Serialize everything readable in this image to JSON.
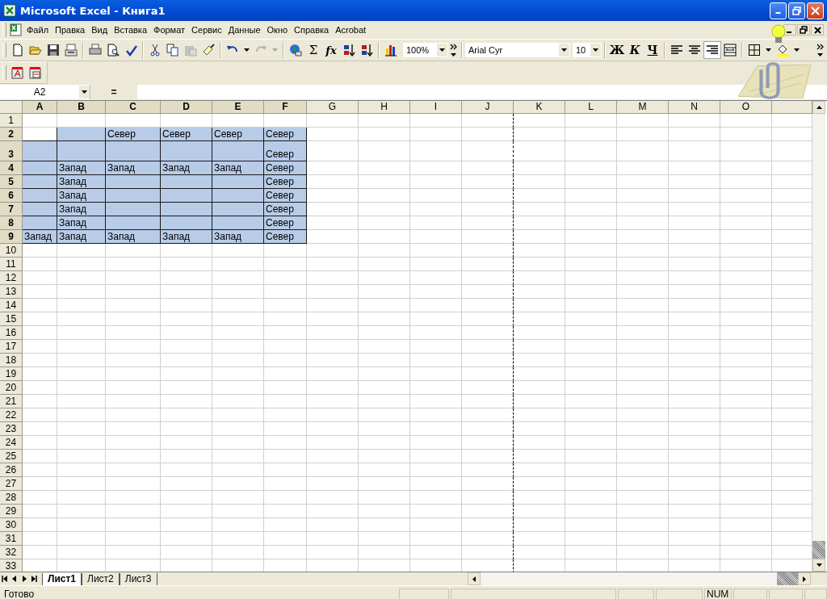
{
  "window": {
    "title": "Microsoft Excel - Книга1"
  },
  "menu": [
    "Файл",
    "Правка",
    "Вид",
    "Вставка",
    "Формат",
    "Сервис",
    "Данные",
    "Окно",
    "Справка",
    "Acrobat"
  ],
  "standard_toolbar": {
    "sum_symbol": "Σ",
    "function_symbol": "fx",
    "zoom": "100%"
  },
  "formatting_toolbar": {
    "font": "Arial Cyr",
    "size": "10",
    "bold": "Ж",
    "italic": "К",
    "underline": "Ч",
    "alignment": [
      {
        "selected": false
      },
      {
        "selected": false
      },
      {
        "selected": true
      },
      {
        "selected": false
      }
    ]
  },
  "formula_bar": {
    "name_box": "A2",
    "equals": "="
  },
  "sheet": {
    "columns": [
      {
        "label": "A",
        "selected": true
      },
      {
        "label": "B",
        "selected": true
      },
      {
        "label": "C",
        "selected": true
      },
      {
        "label": "D",
        "selected": true
      },
      {
        "label": "E",
        "selected": true
      },
      {
        "label": "F",
        "selected": true
      },
      {
        "label": "G",
        "selected": false
      },
      {
        "label": "H",
        "selected": false
      },
      {
        "label": "I",
        "selected": false
      },
      {
        "label": "J",
        "selected": false
      },
      {
        "label": "K",
        "selected": false
      },
      {
        "label": "L",
        "selected": false
      },
      {
        "label": "M",
        "selected": false
      },
      {
        "label": "N",
        "selected": false
      },
      {
        "label": "O",
        "selected": false
      }
    ],
    "rows": [
      {
        "header": "1",
        "selected": false
      },
      {
        "header": "2",
        "selected": true,
        "cells": [
          {
            "selected": true,
            "active": true
          },
          {
            "selected": true
          },
          {
            "text": "Север",
            "selected": true
          },
          {
            "text": "Север",
            "selected": true
          },
          {
            "text": "Север",
            "selected": true
          },
          {
            "text": "Север",
            "selected": true
          }
        ]
      },
      {
        "header": "3",
        "selected": true,
        "kind": "tall",
        "cells": [
          {
            "selected": true
          },
          {
            "selected": true
          },
          {
            "selected": true
          },
          {
            "selected": true
          },
          {
            "selected": true
          },
          {
            "text": "Север",
            "selected": true
          }
        ]
      },
      {
        "header": "4",
        "selected": true,
        "cells": [
          {
            "selected": true
          },
          {
            "text": "Запад",
            "selected": true
          },
          {
            "text": "Запад",
            "selected": true
          },
          {
            "text": "Запад",
            "selected": true
          },
          {
            "text": "Запад",
            "selected": true
          },
          {
            "text": "Север",
            "selected": true
          }
        ]
      },
      {
        "header": "5",
        "selected": true,
        "cells": [
          {
            "selected": true
          },
          {
            "text": "Запад",
            "selected": true
          },
          {
            "selected": true
          },
          {
            "selected": true
          },
          {
            "selected": true
          },
          {
            "text": "Север",
            "selected": true
          }
        ]
      },
      {
        "header": "6",
        "selected": true,
        "cells": [
          {
            "selected": true
          },
          {
            "text": "Запад",
            "selected": true
          },
          {
            "selected": true
          },
          {
            "selected": true
          },
          {
            "selected": true
          },
          {
            "text": "Север",
            "selected": true
          }
        ]
      },
      {
        "header": "7",
        "selected": true,
        "cells": [
          {
            "selected": true
          },
          {
            "text": "Запад",
            "selected": true
          },
          {
            "selected": true
          },
          {
            "selected": true
          },
          {
            "selected": true
          },
          {
            "text": "Север",
            "selected": true
          }
        ]
      },
      {
        "header": "8",
        "selected": true,
        "cells": [
          {
            "selected": true
          },
          {
            "text": "Запад",
            "selected": true
          },
          {
            "selected": true
          },
          {
            "selected": true
          },
          {
            "selected": true
          },
          {
            "text": "Север",
            "selected": true
          }
        ]
      },
      {
        "header": "9",
        "selected": true,
        "cells": [
          {
            "text": "Запад",
            "selected": true
          },
          {
            "text": "Запад",
            "selected": true
          },
          {
            "text": "Запад",
            "selected": true
          },
          {
            "text": "Запад",
            "selected": true
          },
          {
            "text": "Запад",
            "selected": true
          },
          {
            "text": "Север",
            "selected": true
          }
        ]
      },
      {
        "header": "10",
        "selected": false
      },
      {
        "header": "11",
        "selected": false
      },
      {
        "header": "12",
        "selected": false
      },
      {
        "header": "13",
        "selected": false
      },
      {
        "header": "14",
        "selected": false
      },
      {
        "header": "15",
        "selected": false
      },
      {
        "header": "16",
        "selected": false
      },
      {
        "header": "17",
        "selected": false
      },
      {
        "header": "18",
        "selected": false
      },
      {
        "header": "19",
        "selected": false
      },
      {
        "header": "20",
        "selected": false
      },
      {
        "header": "21",
        "selected": false
      },
      {
        "header": "22",
        "selected": false
      },
      {
        "header": "23",
        "selected": false
      },
      {
        "header": "24",
        "selected": false
      },
      {
        "header": "25",
        "selected": false
      },
      {
        "header": "26",
        "selected": false
      },
      {
        "header": "27",
        "selected": false
      },
      {
        "header": "28",
        "selected": false
      },
      {
        "header": "29",
        "selected": false
      },
      {
        "header": "30",
        "selected": false
      },
      {
        "header": "31",
        "selected": false
      },
      {
        "header": "32",
        "selected": false
      },
      {
        "header": "33",
        "selected": false
      }
    ]
  },
  "sheet_tabs": [
    {
      "label": "Лист1",
      "selected": true
    },
    {
      "label": "Лист2",
      "selected": false
    },
    {
      "label": "Лист3",
      "selected": false
    }
  ],
  "status_bar": {
    "message": "Готово",
    "num_indicator": "NUM"
  }
}
